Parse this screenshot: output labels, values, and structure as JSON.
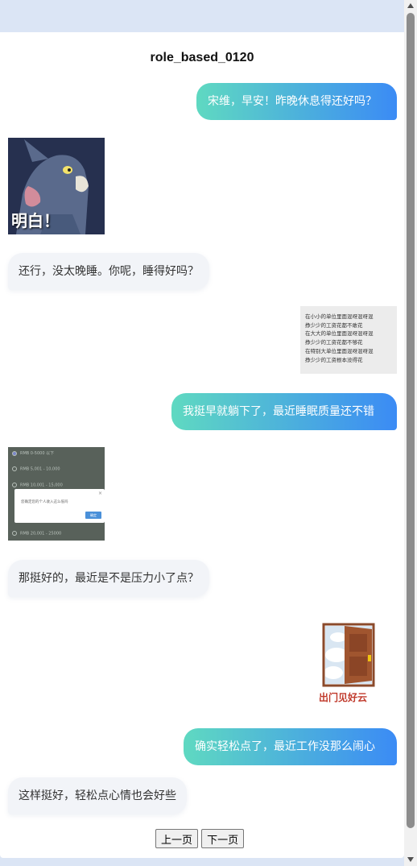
{
  "chat": {
    "title": "role_based_0120",
    "messages": [
      {
        "side": "right",
        "text": "宋维，早安！昨晚休息得还好吗？"
      },
      {
        "side": "left",
        "type": "sticker",
        "caption": "明白！"
      },
      {
        "side": "left",
        "text": "还行，没太晚睡。你呢，睡得好吗？"
      },
      {
        "side": "right",
        "type": "text-image",
        "lines": [
          "在小小的单位里面混呀混呀混",
          "挣少少的工资花都不敢花",
          "在大大的单位里面混呀混呀混",
          "挣少少的工资花都不够花",
          "在特别大单位里面混呀混呀混",
          "挣少少的工资根本没得花"
        ]
      },
      {
        "side": "right",
        "text": "我挺早就躺下了，最近睡眠质量还不错"
      },
      {
        "side": "left",
        "type": "screenshot",
        "options": [
          "RMB 0-5000 以下",
          "RMB 5,001 - 10,000",
          "RMB 10,001 - 15,000",
          "RMB 20,001 - 25000"
        ],
        "dialog_text": "您确定您的个人收入这么低吗",
        "dialog_button": "确定"
      },
      {
        "side": "left",
        "text": "那挺好的，最近是不是压力小了点？"
      },
      {
        "side": "right",
        "type": "sticker",
        "caption": "出门见好云"
      },
      {
        "side": "right",
        "text": "确实轻松点了，最近工作没那么闹心"
      },
      {
        "side": "left",
        "text": "这样挺好，轻松点心情也会好些"
      }
    ]
  },
  "pager": {
    "prev_label": "上一页",
    "next_label": "下一页"
  },
  "colors": {
    "bubble_gradient_start": "#5fd9c1",
    "bubble_gradient_end": "#3b8bf5",
    "left_bubble_bg": "#f2f4f8",
    "page_bg": "#dde6f4"
  }
}
